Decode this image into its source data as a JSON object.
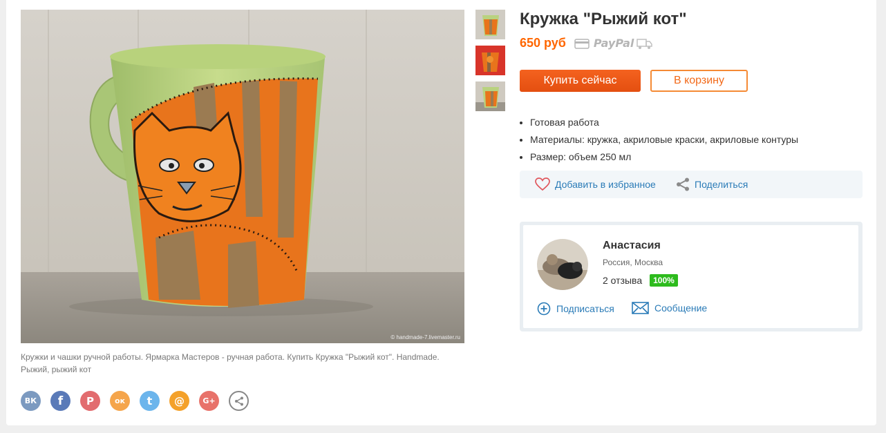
{
  "product": {
    "title": "Кружка \"Рыжий кот\"",
    "price": "650 руб",
    "payment": "PayPal",
    "buy_label": "Купить сейчас",
    "cart_label": "В корзину",
    "properties": [
      "Готовая работа",
      "Материалы:  кружка, акриловые краски, акриловые контуры",
      "Размер: объем 250 мл"
    ]
  },
  "photo": {
    "credit": "© handmade-7.livemaster.ru",
    "caption": "Кружки и чашки ручной работы. Ярмарка Мастеров - ручная работа. Купить Кружка \"Рыжий кот\". Handmade. Рыжий, рыжий кот"
  },
  "actions": {
    "favorite_label": "Добавить в избранное",
    "share_label": "Поделиться"
  },
  "seller": {
    "name": "Анастасия",
    "location": "Россия, Москва",
    "reviews": "2 отзыва",
    "rating": "100%",
    "subscribe_label": "Подписаться",
    "message_label": "Сообщение"
  },
  "social": {
    "vk": "ВК",
    "facebook": "f",
    "pinterest": "P",
    "ok": "ок",
    "twitter": "t",
    "mail": "@",
    "google": "G+",
    "colors": {
      "vk": "#7c9ac0",
      "facebook": "#5a7ab8",
      "pinterest": "#e26c6f",
      "ok": "#f5a54b",
      "twitter": "#6cb5ec",
      "mail": "#f4a12a",
      "google": "#e8726a"
    }
  },
  "colors": {
    "accent": "#f26a1a",
    "link": "#2a7bb7",
    "rating": "#2dbb1d"
  }
}
